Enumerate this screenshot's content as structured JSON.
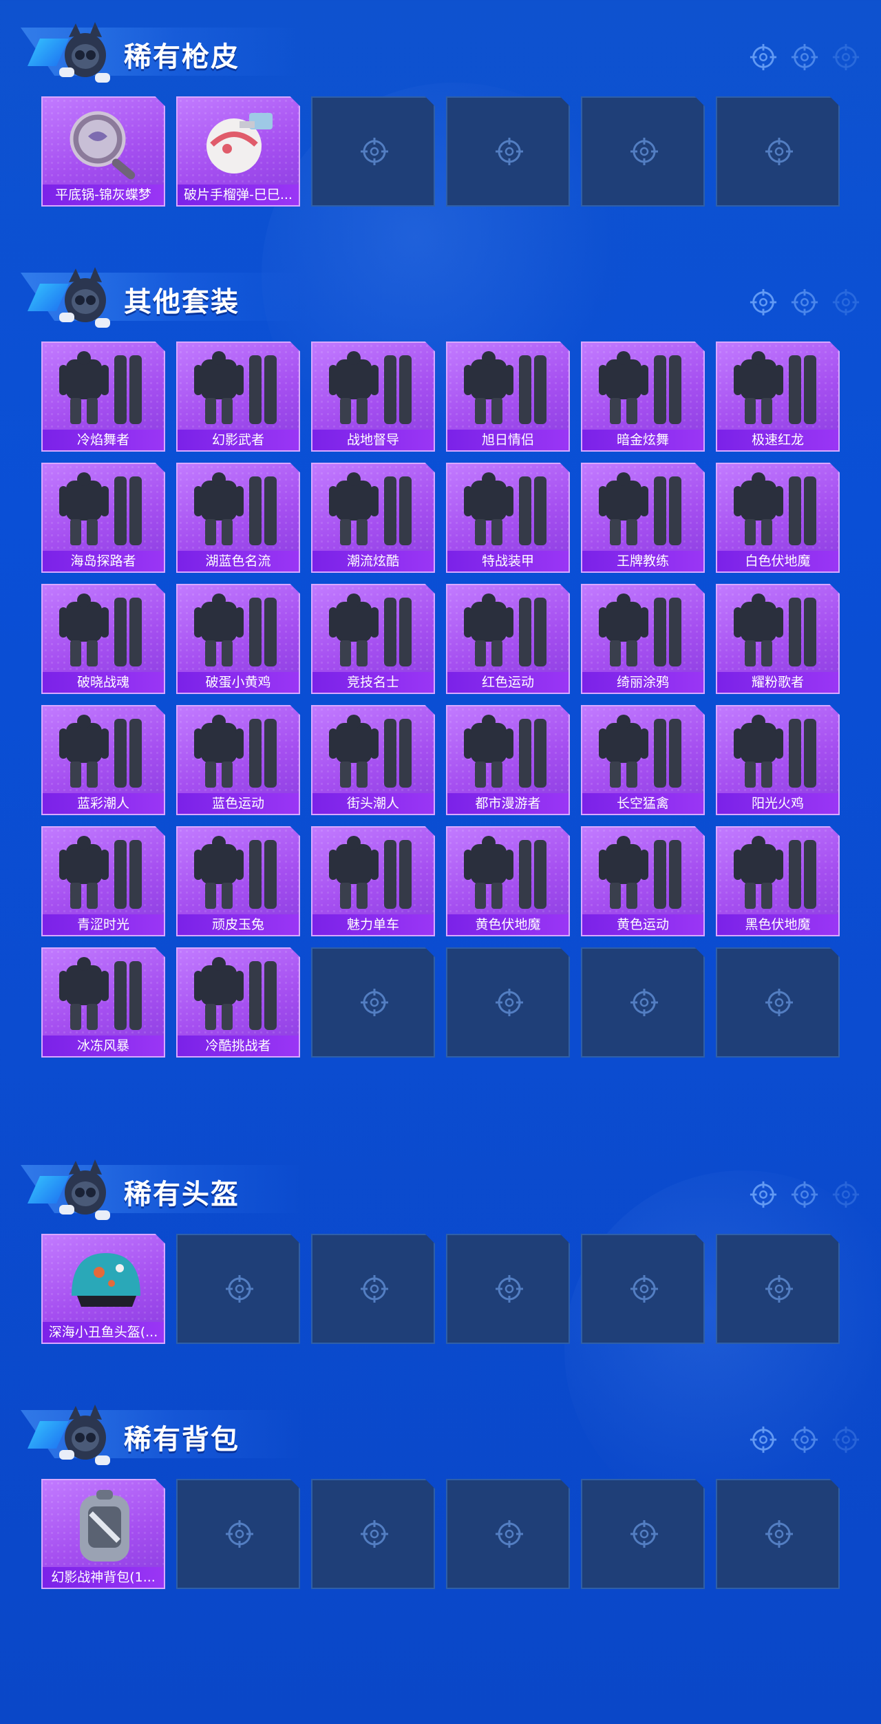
{
  "sections": [
    {
      "title": "稀有枪皮",
      "items": [
        {
          "label": "平底锅-锦灰蝶梦",
          "art": "pan-icon"
        },
        {
          "label": "破片手榴弹-巳巳...",
          "art": "grenade-icon"
        },
        null,
        null,
        null,
        null
      ]
    },
    {
      "title": "其他套装",
      "items": [
        {
          "label": "冷焰舞者",
          "art": "outfit-icon"
        },
        {
          "label": "幻影武者",
          "art": "outfit-icon"
        },
        {
          "label": "战地督导",
          "art": "outfit-icon"
        },
        {
          "label": "旭日情侣",
          "art": "outfit-icon"
        },
        {
          "label": "暗金炫舞",
          "art": "outfit-icon"
        },
        {
          "label": "极速红龙",
          "art": "outfit-icon"
        },
        {
          "label": "海岛探路者",
          "art": "outfit-icon"
        },
        {
          "label": "湖蓝色名流",
          "art": "outfit-icon"
        },
        {
          "label": "潮流炫酷",
          "art": "outfit-icon"
        },
        {
          "label": "特战装甲",
          "art": "outfit-icon"
        },
        {
          "label": "王牌教练",
          "art": "outfit-icon"
        },
        {
          "label": "白色伏地魔",
          "art": "outfit-icon"
        },
        {
          "label": "破晓战魂",
          "art": "outfit-icon"
        },
        {
          "label": "破蛋小黄鸡",
          "art": "outfit-icon"
        },
        {
          "label": "竞技名士",
          "art": "outfit-icon"
        },
        {
          "label": "红色运动",
          "art": "outfit-icon"
        },
        {
          "label": "绮丽涂鸦",
          "art": "outfit-icon"
        },
        {
          "label": "耀粉歌者",
          "art": "outfit-icon"
        },
        {
          "label": "蓝彩潮人",
          "art": "outfit-icon"
        },
        {
          "label": "蓝色运动",
          "art": "outfit-icon"
        },
        {
          "label": "街头潮人",
          "art": "outfit-icon"
        },
        {
          "label": "都市漫游者",
          "art": "outfit-icon"
        },
        {
          "label": "长空猛禽",
          "art": "outfit-icon"
        },
        {
          "label": "阳光火鸡",
          "art": "outfit-icon"
        },
        {
          "label": "青涩时光",
          "art": "outfit-icon"
        },
        {
          "label": "顽皮玉兔",
          "art": "outfit-icon"
        },
        {
          "label": "魅力单车",
          "art": "outfit-icon"
        },
        {
          "label": "黄色伏地魔",
          "art": "outfit-icon"
        },
        {
          "label": "黄色运动",
          "art": "outfit-icon"
        },
        {
          "label": "黑色伏地魔",
          "art": "outfit-icon"
        },
        {
          "label": "冰冻风暴",
          "art": "outfit-icon"
        },
        {
          "label": "冷酷挑战者",
          "art": "outfit-icon"
        },
        null,
        null,
        null,
        null
      ]
    },
    {
      "title": "稀有头盔",
      "items": [
        {
          "label": "深海小丑鱼头盔(...",
          "art": "helmet-icon"
        },
        null,
        null,
        null,
        null,
        null
      ]
    },
    {
      "title": "稀有背包",
      "items": [
        {
          "label": "幻影战神背包(1...",
          "art": "backpack-icon"
        },
        null,
        null,
        null,
        null,
        null
      ]
    }
  ],
  "colors": {
    "background": "#0a4fd6",
    "card_filled": "#a54ff0",
    "card_label": "#7b22e8",
    "card_empty": "#1f3f78"
  }
}
